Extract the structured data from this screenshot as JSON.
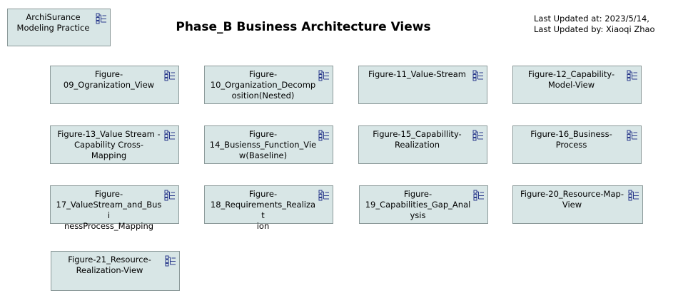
{
  "header": {
    "title": "Phase_B Business Architecture Views",
    "last_updated_at": "Last Updated at: 2023/5/14,",
    "last_updated_by": "Last Updated by: Xiaoqi Zhao"
  },
  "practice_node": {
    "label": "ArchiSurance\nModeling Practice",
    "icon": "diagram-reference-icon"
  },
  "view_nodes": [
    {
      "label": "Figure-\n09_Ogranization_View",
      "icon": "diagram-reference-icon"
    },
    {
      "label": "Figure-\n10_Organization_Decomp\nosition(Nested)",
      "icon": "diagram-reference-icon"
    },
    {
      "label": "Figure-11_Value-Stream",
      "icon": "diagram-reference-icon"
    },
    {
      "label": "Figure-12_Capability-\nModel-View",
      "icon": "diagram-reference-icon"
    },
    {
      "label": "Figure-13_Value Stream -\nCapability Cross-\nMapping",
      "icon": "diagram-reference-icon"
    },
    {
      "label": "Figure-\n14_Busienss_Function_Vie\nw(Baseline)",
      "icon": "diagram-reference-icon"
    },
    {
      "label": "Figure-15_Capabillity-\nRealization",
      "icon": "diagram-reference-icon"
    },
    {
      "label": "Figure-16_Business-\nProcess",
      "icon": "diagram-reference-icon"
    },
    {
      "label": "Figure-\n17_ValueStream_and_Busi\nnessProcess_Mapping",
      "icon": "diagram-reference-icon"
    },
    {
      "label": "Figure-\n18_Requirements_Realizat\nion",
      "icon": "diagram-reference-icon"
    },
    {
      "label": "Figure-\n19_Capabilities_Gap_Anal\nysis",
      "icon": "diagram-reference-icon"
    },
    {
      "label": "Figure-20_Resource-Map-\nView",
      "icon": "diagram-reference-icon"
    },
    {
      "label": "Figure-21_Resource-\nRealization-View",
      "icon": "diagram-reference-icon"
    }
  ],
  "colors": {
    "node_fill": "#d8e6e6",
    "node_border": "#8c9a9a",
    "icon_stroke": "#2a3a8c"
  }
}
